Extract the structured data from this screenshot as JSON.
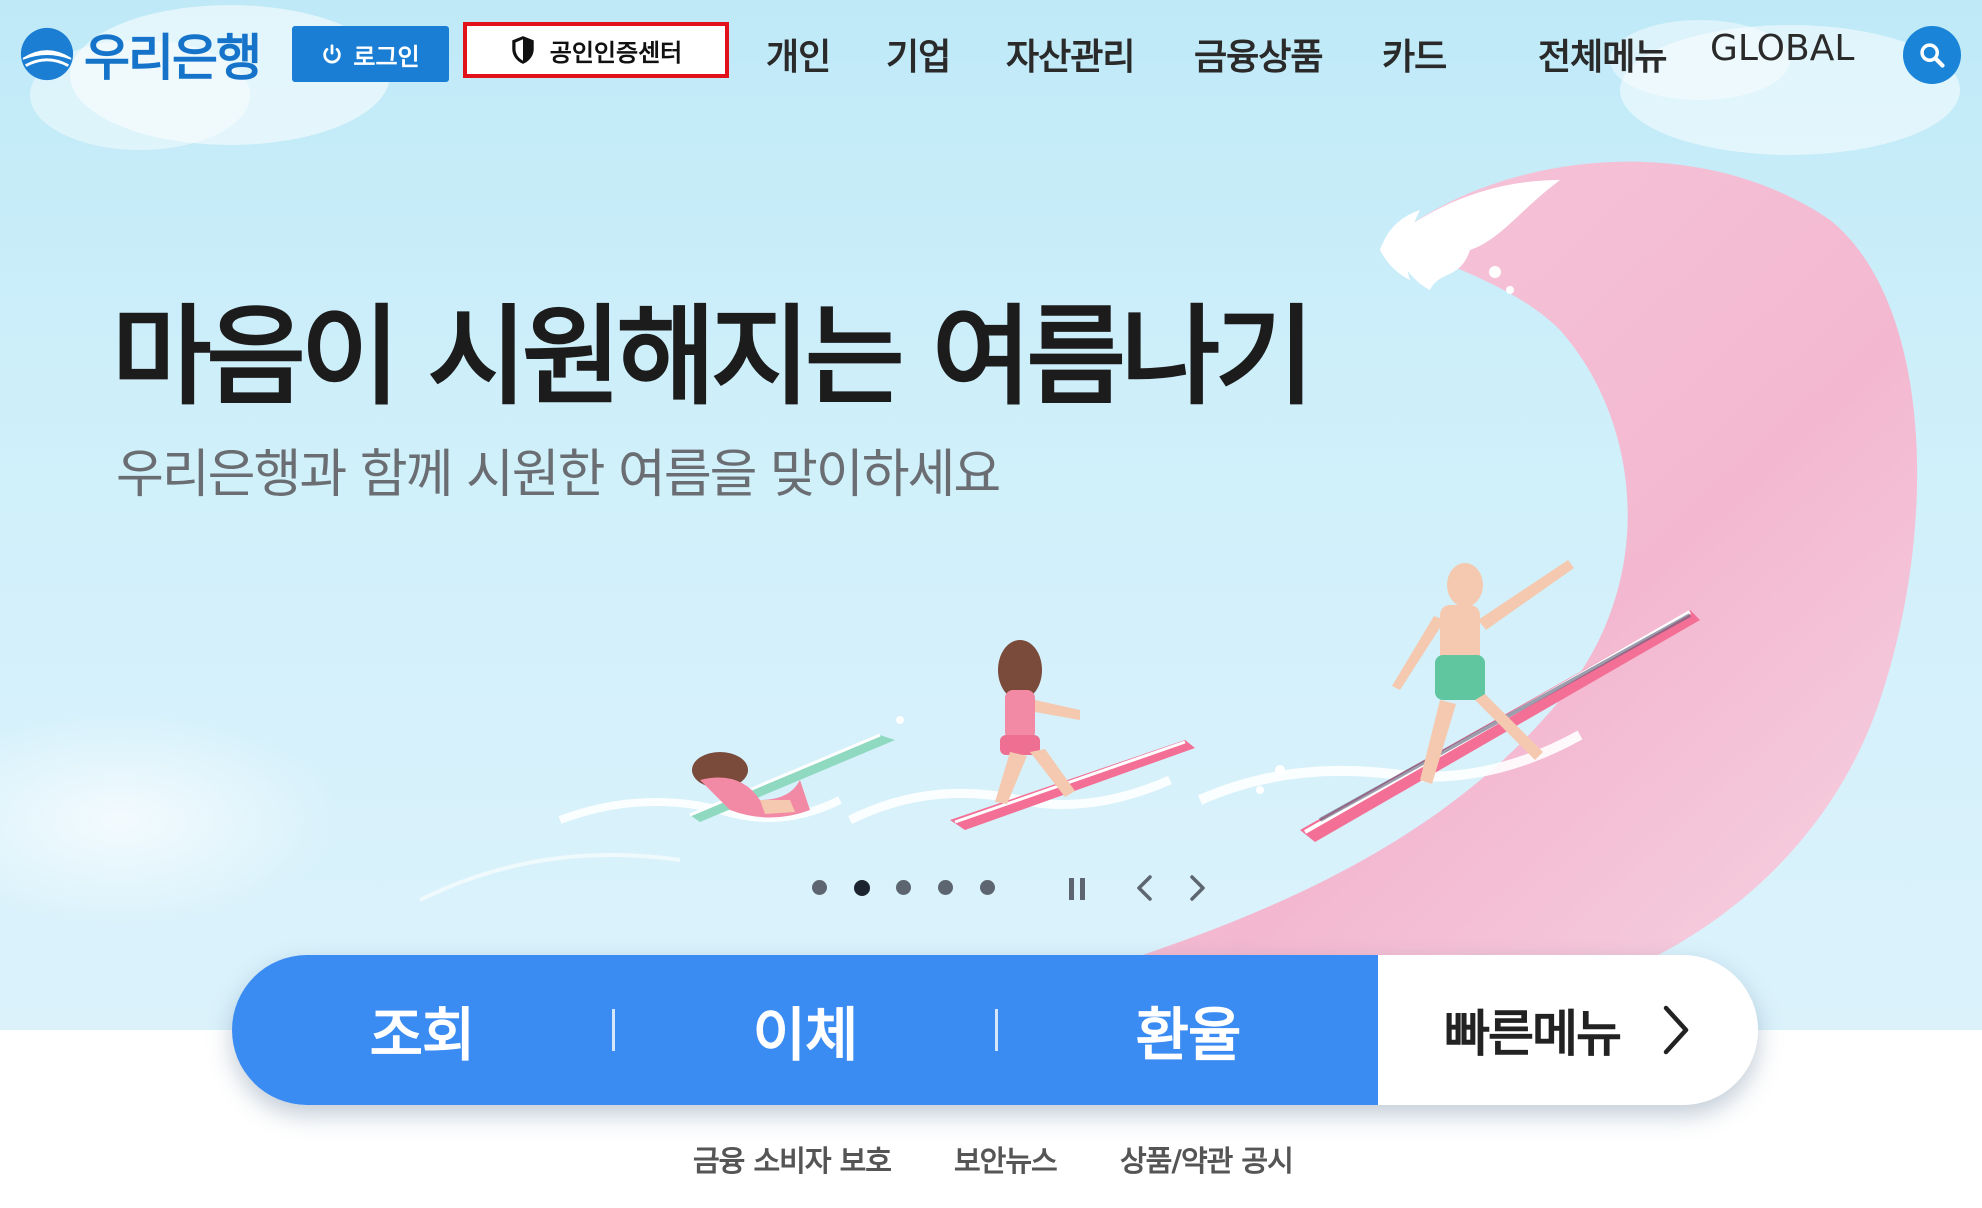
{
  "brand": {
    "name": "우리은행",
    "accent": "#1574c9"
  },
  "header": {
    "login_label": "로그인",
    "cert_label": "공인인증센터",
    "nav": [
      "개인",
      "기업",
      "자산관리",
      "금융상품",
      "카드"
    ],
    "all_menu": "전체메뉴",
    "global": "GLOBAL",
    "search_icon": "search-icon"
  },
  "hero": {
    "title": "마음이 시원해지는 여름나기",
    "subtitle": "우리은행과 함께 시원한 여름을 맞이하세요"
  },
  "carousel": {
    "slide_count": 5,
    "active_index": 1,
    "pause_icon": "pause-icon",
    "prev_icon": "chevron-left-icon",
    "next_icon": "chevron-right-icon"
  },
  "quick_bar": {
    "items": [
      "조회",
      "이체",
      "환율"
    ],
    "quick_menu": "빠른메뉴",
    "quick_menu_icon": "chevron-right-icon",
    "color": "#3a8bf2"
  },
  "footer_links": [
    "금융 소비자 보호",
    "보안뉴스",
    "상품/약관 공시"
  ]
}
